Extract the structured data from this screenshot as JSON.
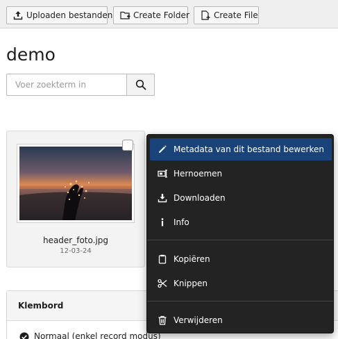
{
  "toolbar": {
    "upload_label": "Uploaden bestanden",
    "create_folder_label": "Create Folder",
    "create_file_label": "Create File"
  },
  "page": {
    "title": "demo"
  },
  "search": {
    "placeholder": "Voer zoekterm in",
    "value": ""
  },
  "file": {
    "name": "header_foto.jpg",
    "date": "12-03-24",
    "selected": false
  },
  "clipboard": {
    "title": "Klembord",
    "mode_label": "Normaal (enkel record modus)"
  },
  "context_menu": {
    "items": [
      {
        "label": "Metadata van dit bestand bewerken",
        "icon": "pencil-icon",
        "active": true
      },
      {
        "label": "Hernoemen",
        "icon": "rename-icon"
      },
      {
        "label": "Downloaden",
        "icon": "download-icon"
      },
      {
        "label": "Info",
        "icon": "info-icon"
      },
      {
        "label": "Kopiëren",
        "icon": "copy-icon"
      },
      {
        "label": "Knippen",
        "icon": "scissors-icon"
      },
      {
        "label": "Verwijderen",
        "icon": "trash-icon"
      }
    ]
  },
  "colors": {
    "menu_background": "#232323",
    "menu_active": "#1a4479",
    "toolbar_background": "#efefef"
  }
}
